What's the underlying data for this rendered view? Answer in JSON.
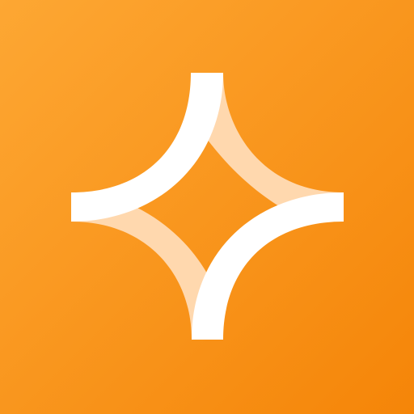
{
  "icon": {
    "name": "sparkle-star-logo-icon",
    "colors": {
      "gradient_start": "#FDA733",
      "gradient_end": "#F58508",
      "primary_stroke": "#FFFFFF",
      "secondary_stroke": "#FFD8AE"
    }
  }
}
